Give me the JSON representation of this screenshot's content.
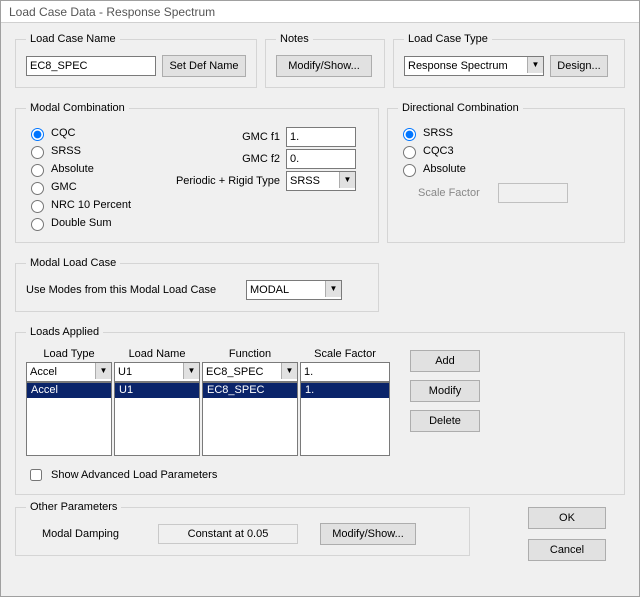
{
  "window": {
    "title": "Load Case Data - Response Spectrum"
  },
  "lcname": {
    "legend": "Load Case Name",
    "value": "EC8_SPEC",
    "setdef_btn": "Set Def Name"
  },
  "notes": {
    "legend": "Notes",
    "modify_btn": "Modify/Show..."
  },
  "lctype": {
    "legend": "Load Case Type",
    "value": "Response Spectrum",
    "design_btn": "Design..."
  },
  "modalcomb": {
    "legend": "Modal Combination",
    "options": {
      "cqc": "CQC",
      "srss": "SRSS",
      "absolute": "Absolute",
      "gmc": "GMC",
      "nrc10": "NRC 10 Percent",
      "doublesum": "Double Sum"
    },
    "gmc_f1_label": "GMC  f1",
    "gmc_f1_value": "1.",
    "gmc_f2_label": "GMC  f2",
    "gmc_f2_value": "0.",
    "prt_label": "Periodic + Rigid Type",
    "prt_value": "SRSS"
  },
  "dircomb": {
    "legend": "Directional Combination",
    "options": {
      "srss": "SRSS",
      "cqc3": "CQC3",
      "absolute": "Absolute"
    },
    "scale_label": "Scale Factor",
    "scale_value": ""
  },
  "modalload": {
    "legend": "Modal Load Case",
    "label": "Use Modes from this Modal Load Case",
    "value": "MODAL"
  },
  "loads": {
    "legend": "Loads Applied",
    "headers": {
      "loadtype": "Load Type",
      "loadname": "Load Name",
      "function": "Function",
      "scalefactor": "Scale Factor"
    },
    "inputs": {
      "loadtype": "Accel",
      "loadname": "U1",
      "function": "EC8_SPEC",
      "scalefactor": "1."
    },
    "row": {
      "loadtype": "Accel",
      "loadname": "U1",
      "function": "EC8_SPEC",
      "scalefactor": "1."
    },
    "btns": {
      "add": "Add",
      "modify": "Modify",
      "delete": "Delete"
    },
    "advanced_cb": "Show Advanced Load Parameters"
  },
  "other": {
    "legend": "Other Parameters",
    "damping_label": "Modal Damping",
    "damping_value": "Constant at 0.05",
    "modify_btn": "Modify/Show..."
  },
  "footer": {
    "ok": "OK",
    "cancel": "Cancel"
  }
}
